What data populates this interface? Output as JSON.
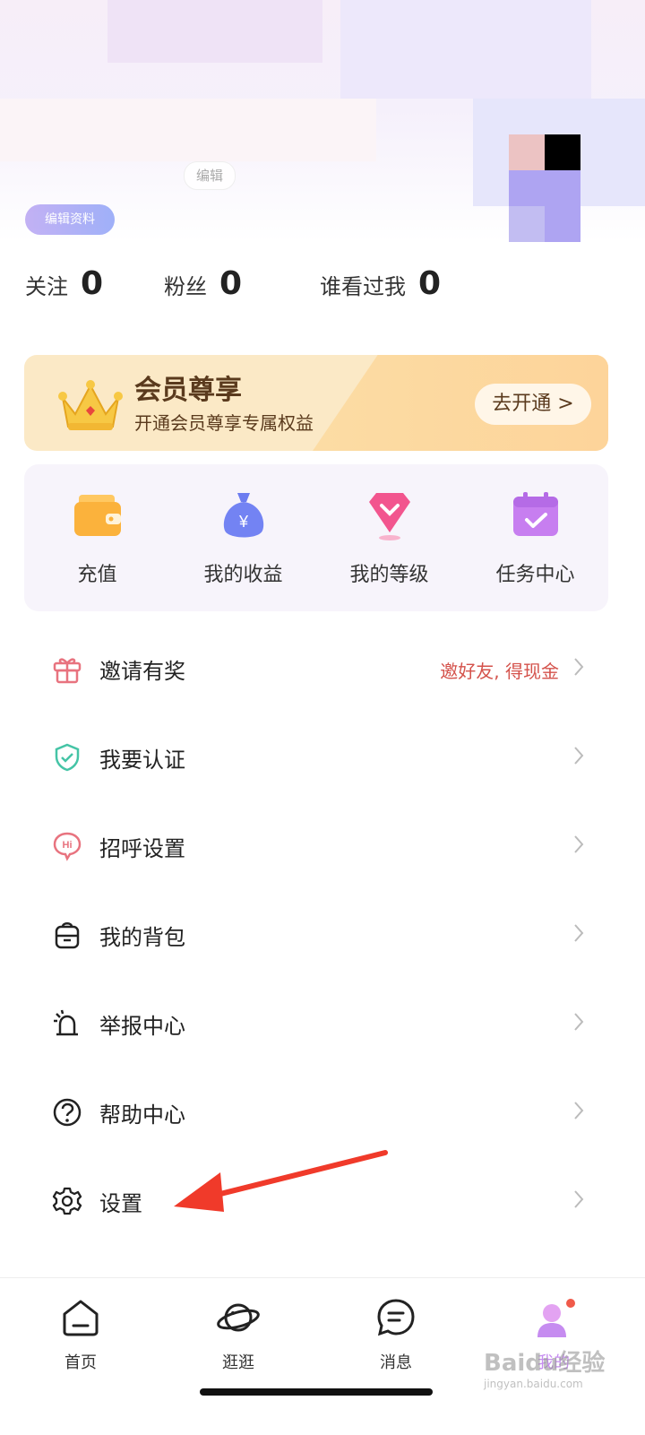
{
  "header": {
    "edit_chip": "编辑",
    "edit_profile": "编辑资料"
  },
  "stats": [
    {
      "label": "关注",
      "value": "0"
    },
    {
      "label": "粉丝",
      "value": "0"
    },
    {
      "label": "谁看过我",
      "value": "0"
    }
  ],
  "vip": {
    "title": "会员尊享",
    "subtitle": "开通会员尊享专属权益",
    "button": "去开通 >"
  },
  "quick_actions": [
    {
      "label": "充值",
      "icon": "wallet-icon"
    },
    {
      "label": "我的收益",
      "icon": "money-bag-icon"
    },
    {
      "label": "我的等级",
      "icon": "diamond-level-icon"
    },
    {
      "label": "任务中心",
      "icon": "calendar-task-icon"
    }
  ],
  "menu": [
    {
      "label": "邀请有奖",
      "extra": "邀好友, 得现金",
      "icon": "gift-icon"
    },
    {
      "label": "我要认证",
      "extra": "",
      "icon": "shield-check-icon"
    },
    {
      "label": "招呼设置",
      "extra": "",
      "icon": "hi-bubble-icon"
    },
    {
      "label": "我的背包",
      "extra": "",
      "icon": "backpack-icon"
    },
    {
      "label": "举报中心",
      "extra": "",
      "icon": "alarm-icon"
    },
    {
      "label": "帮助中心",
      "extra": "",
      "icon": "question-circle-icon"
    },
    {
      "label": "设置",
      "extra": "",
      "icon": "gear-icon"
    }
  ],
  "tabbar": [
    {
      "label": "首页",
      "icon": "home-icon"
    },
    {
      "label": "逛逛",
      "icon": "planet-icon"
    },
    {
      "label": "消息",
      "icon": "chat-bubble-icon"
    },
    {
      "label": "我的",
      "icon": "profile-icon"
    }
  ],
  "watermark": {
    "brand": "Baidu经验",
    "url": "jingyan.baidu.com"
  },
  "colors": {
    "accent": "#c68cf0",
    "invite_text": "#d4524b",
    "vip_text": "#5a3a1d"
  }
}
